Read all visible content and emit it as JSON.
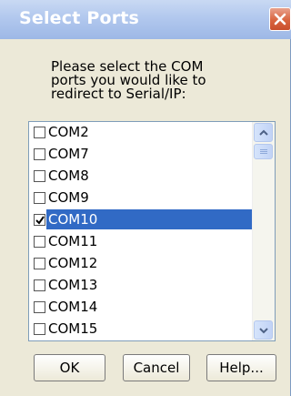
{
  "window": {
    "title": "Select Ports"
  },
  "prompt": "Please select the COM\nports you would like to\nredirect to Serial/IP:",
  "ports": [
    {
      "label": "COM2",
      "checked": false,
      "selected": false
    },
    {
      "label": "COM7",
      "checked": false,
      "selected": false
    },
    {
      "label": "COM8",
      "checked": false,
      "selected": false
    },
    {
      "label": "COM9",
      "checked": false,
      "selected": false
    },
    {
      "label": "COM10",
      "checked": true,
      "selected": true
    },
    {
      "label": "COM11",
      "checked": false,
      "selected": false
    },
    {
      "label": "COM12",
      "checked": false,
      "selected": false
    },
    {
      "label": "COM13",
      "checked": false,
      "selected": false
    },
    {
      "label": "COM14",
      "checked": false,
      "selected": false
    },
    {
      "label": "COM15",
      "checked": false,
      "selected": false
    }
  ],
  "buttons": {
    "ok": "OK",
    "cancel": "Cancel",
    "help": "Help..."
  },
  "colors": {
    "selection": "#316ac5",
    "title_bar": "#9db8e6",
    "close": "#d9653f",
    "dialog_bg": "#ece9d8"
  },
  "icons": {
    "close": "close-icon",
    "scroll_up": "chevron-up-icon",
    "scroll_down": "chevron-down-icon"
  }
}
